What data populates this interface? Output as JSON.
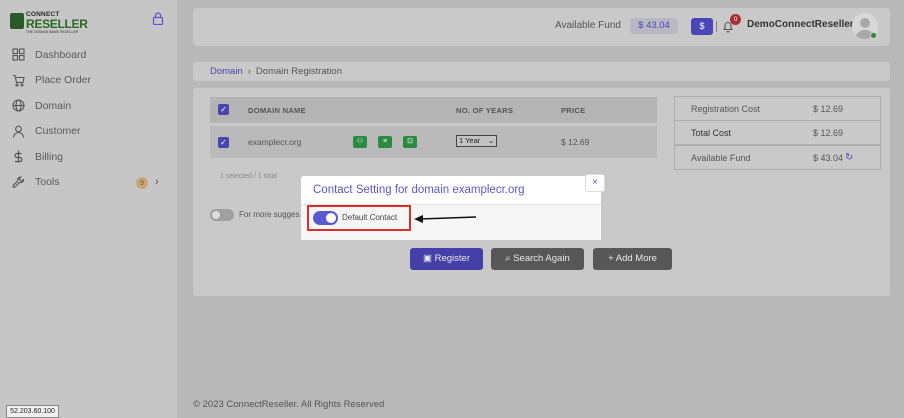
{
  "brand": {
    "line1": "CONNECT",
    "line2": "RESELLER",
    "tagline": "THE DOMAIN NAME RESELLER"
  },
  "sidebar": {
    "items": [
      {
        "label": "Dashboard",
        "icon": "grid-icon"
      },
      {
        "label": "Place Order",
        "icon": "cart-icon"
      },
      {
        "label": "Domain",
        "icon": "globe-icon"
      },
      {
        "label": "Customer",
        "icon": "user-icon"
      },
      {
        "label": "Billing",
        "icon": "dollar-icon"
      },
      {
        "label": "Tools",
        "icon": "wrench-icon",
        "badge": "9"
      }
    ]
  },
  "header": {
    "available_fund_label": "Available Fund",
    "available_fund_value": "$ 43.04",
    "dollar_button": "$",
    "notification_count": "0",
    "username": "DemoConnectReseller"
  },
  "breadcrumb": {
    "link": "Domain",
    "separator": "›",
    "current": "Domain Registration"
  },
  "table": {
    "headers": {
      "domain": "DOMAIN NAME",
      "years": "NO. OF YEARS",
      "price": "PRICE"
    },
    "rows": [
      {
        "domain": "examplecr.org",
        "years": "1 Year",
        "price": "$ 12.69",
        "checked": true
      }
    ],
    "selection_text": "1 selected / 1 total"
  },
  "suggestions": {
    "label": "For more sugges"
  },
  "summary": {
    "rows": [
      {
        "label": "Registration Cost",
        "value": "$ 12.69"
      },
      {
        "label": "Total Cost",
        "value": "$ 12.69"
      },
      {
        "label": "Available Fund",
        "value": "$ 43.04"
      }
    ]
  },
  "actions": {
    "register": "Register",
    "search_again": "Search Again",
    "add_more": "Add More"
  },
  "modal": {
    "title": "Contact Setting for domain examplecr.org",
    "close": "×",
    "toggle_label": "Default Contact",
    "toggle_on": true
  },
  "footer": {
    "copyright": "© 2023 ConnectReseller. All Rights Reserved"
  },
  "ip_box": "52.203.60.100",
  "colors": {
    "accent": "#4a46b8",
    "success": "#2c8a43",
    "danger": "#d62f2f"
  }
}
